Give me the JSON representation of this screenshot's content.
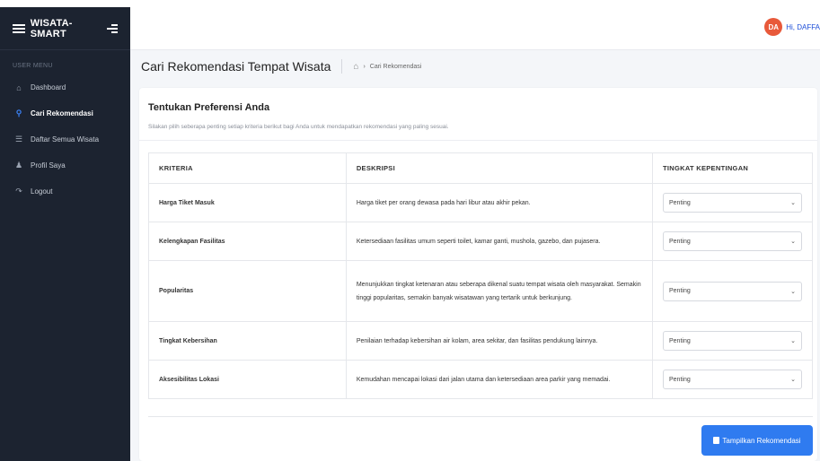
{
  "brand": {
    "name": "WISATA-SMART"
  },
  "user": {
    "initials": "DA",
    "greeting": "Hi, DAFFA"
  },
  "sidebar": {
    "section_label": "USER MENU",
    "items": [
      {
        "label": "Dashboard",
        "icon": "home-icon"
      },
      {
        "label": "Cari Rekomendasi",
        "icon": "search-icon"
      },
      {
        "label": "Daftar Semua Wisata",
        "icon": "list-icon"
      },
      {
        "label": "Profil Saya",
        "icon": "users-icon"
      },
      {
        "label": "Logout",
        "icon": "logout-icon"
      }
    ]
  },
  "page": {
    "title": "Cari Rekomendasi Tempat Wisata",
    "breadcrumb": "Cari Rekomendasi"
  },
  "card": {
    "title": "Tentukan Preferensi Anda",
    "subtitle": "Silakan pilih seberapa penting setiap kriteria berikut bagi Anda untuk mendapatkan rekomendasi yang paling sesuai."
  },
  "table": {
    "headers": [
      "KRITERIA",
      "DESKRIPSI",
      "TINGKAT KEPENTINGAN"
    ],
    "rows": [
      {
        "kriteria": "Harga Tiket Masuk",
        "deskripsi": "Harga tiket per orang dewasa pada hari libur atau akhir pekan.",
        "tingkat": "Penting"
      },
      {
        "kriteria": "Kelengkapan Fasilitas",
        "deskripsi": "Ketersediaan fasilitas umum seperti toilet, kamar ganti, mushola, gazebo, dan pujasera.",
        "tingkat": "Penting"
      },
      {
        "kriteria": "Popularitas",
        "deskripsi": "Menunjukkan tingkat ketenaran atau seberapa dikenal suatu tempat wisata oleh masyarakat. Semakin tinggi popularitas, semakin banyak wisatawan yang tertarik untuk berkunjung.",
        "tingkat": "Penting"
      },
      {
        "kriteria": "Tingkat Kebersihan",
        "deskripsi": "Penilaian terhadap kebersihan air kolam, area sekitar, dan fasilitas pendukung lainnya.",
        "tingkat": "Penting"
      },
      {
        "kriteria": "Aksesibilitas Lokasi",
        "deskripsi": "Kemudahan mencapai lokasi dari jalan utama dan ketersediaan area parkir yang memadai.",
        "tingkat": "Penting"
      }
    ]
  },
  "submit_label": "Tampilkan Rekomendasi"
}
